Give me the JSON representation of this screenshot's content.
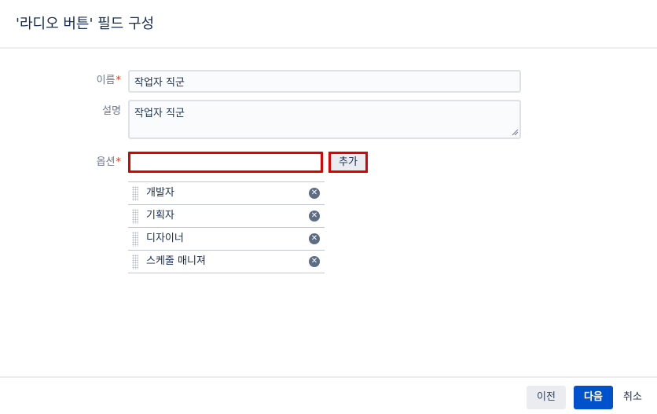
{
  "dialog": {
    "title": "'라디오 버튼' 필드 구성"
  },
  "form": {
    "name_label": "이름",
    "name_value": "작업자 직군",
    "description_label": "설명",
    "description_value": "작업자 직군",
    "options_label": "옵션",
    "required_marker": "*",
    "option_input_value": "",
    "add_button_label": "추가"
  },
  "options": [
    {
      "label": "개발자"
    },
    {
      "label": "기획자"
    },
    {
      "label": "디자이너"
    },
    {
      "label": "스케줄 매니져"
    }
  ],
  "footer": {
    "prev_label": "이전",
    "next_label": "다음",
    "cancel_label": "취소"
  },
  "colors": {
    "primary": "#0052cc",
    "highlight": "#e00000",
    "required": "#de350b"
  },
  "icons": {
    "remove": "close-circle-icon",
    "drag": "drag-handle-icon"
  }
}
